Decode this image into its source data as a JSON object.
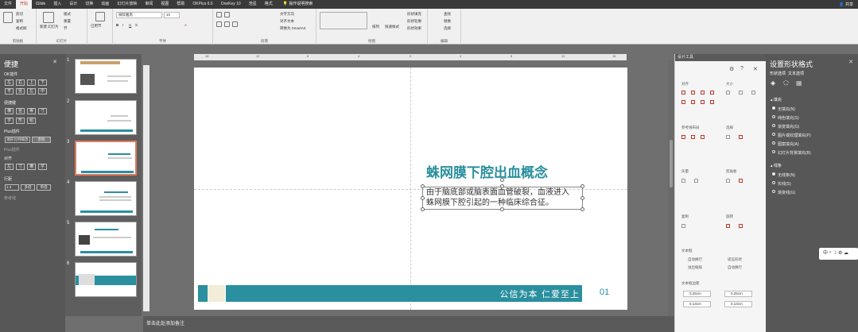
{
  "menubar": {
    "tabs": [
      "文件",
      "开始",
      "iSlide",
      "插入",
      "设计",
      "切换",
      "动画",
      "幻灯片放映",
      "审阅",
      "视图",
      "帮助",
      "OKPlus 6.6",
      "OneKey 10",
      "浩星",
      "格式"
    ],
    "active_tab": "开始",
    "help_text": "操作说明搜索",
    "share_label": "共享"
  },
  "ribbon": {
    "clipboard": {
      "cut": "剪切",
      "copy": "复制",
      "format_painter": "格式刷",
      "label": "剪贴板"
    },
    "slides": {
      "new_slide": "新建\n幻灯片",
      "layout": "版式",
      "reset": "重置",
      "section": "节",
      "label": "幻灯片"
    },
    "section_btn": "已用节",
    "font": {
      "name": "微软雅黑",
      "size": "10",
      "label": "字体"
    },
    "paragraph": {
      "text_direction": "文字方向",
      "align_text": "对齐文本",
      "smartart": "转换为 SmartArt",
      "label": "段落"
    },
    "drawing": {
      "arrange": "排列",
      "quick_styles": "快速样式",
      "fill": "形状填充",
      "outline": "形状轮廓",
      "effects": "形状效果",
      "label": "绘图"
    },
    "editing": {
      "find": "查找",
      "replace": "替换",
      "select": "选择",
      "label": "编辑"
    }
  },
  "left_panel": {
    "title": "便捷",
    "ok_plugin": "OK插件",
    "row1": [
      "左",
      "右",
      "上",
      "下"
    ],
    "row2": [
      "平",
      "竖",
      "左",
      "中"
    ],
    "convenient": "便捷键",
    "row3": [
      "横",
      "竖",
      "等",
      "寸"
    ],
    "row4": [
      "字",
      "形",
      "组"
    ],
    "plus_plugin": "Plus插件",
    "plus_btn1": "图形比例缩放",
    "plus_btn2": "参照",
    "plus_plugin2": "Plus插件",
    "align": "对齐",
    "row5": [
      "左",
      "寸",
      "横",
      "字"
    ],
    "line_spacing": "行距",
    "line_val": "1.3",
    "line_btn1": "多倍",
    "line_btn2": "单倍",
    "ref": "参考线"
  },
  "thumbnails": [
    {
      "num": "1"
    },
    {
      "num": "2"
    },
    {
      "num": "3"
    },
    {
      "num": "4"
    },
    {
      "num": "5"
    },
    {
      "num": "6"
    }
  ],
  "slide": {
    "title": "蛛网膜下腔出血概念",
    "body_line1": "由于脑底部或脑表面血管破裂，血液进入",
    "body_line2": "蛛网膜下腔引起的一种临床综合征。",
    "footer_text": "公信为本  仁爱至上",
    "page_number": "01",
    "colors": {
      "teal": "#2a8f9e",
      "cream": "#f2ecd8"
    }
  },
  "notes": {
    "placeholder": "单击此处添加备注"
  },
  "design_tools": {
    "title": "设计工具",
    "align": "对齐",
    "size": "大小",
    "guides": "参考线布局",
    "select": "选择",
    "vector": "矢量",
    "clipboard": "剪贴板",
    "copy": "复制",
    "rotate": "旋转",
    "textbox": "文本框",
    "autofit": "自动换行",
    "fit_shape": "适应形状",
    "shrink": "溢出缩排",
    "wrap": "自动换行",
    "margins": "文本框边距",
    "m1": "0.25cm",
    "m2": "0.25cm",
    "m3": "0.13cm",
    "m4": "0.13cm"
  },
  "format_panel": {
    "title": "设置形状格式",
    "tab1": "形状选项",
    "tab2": "文本选项",
    "fill_section": "填充",
    "fill_options": [
      "无填充(N)",
      "纯色填充(S)",
      "渐变填充(G)",
      "图片或纹理填充(P)",
      "图案填充(A)",
      "幻灯片背景填充(B)"
    ],
    "line_section": "线条",
    "line_options": [
      "无线条(N)",
      "实线(S)",
      "渐变线(G)"
    ]
  },
  "ime": {
    "text": "中 ⁴ ☽ ⚙ ☁"
  }
}
